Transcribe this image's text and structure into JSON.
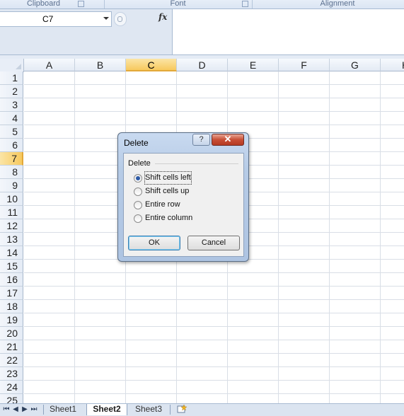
{
  "ribbon": {
    "groups": [
      "Clipboard",
      "Font",
      "Alignment"
    ]
  },
  "formula_bar": {
    "name_box": "C7",
    "fx_label": "fx",
    "content": ""
  },
  "grid": {
    "columns": [
      "A",
      "B",
      "C",
      "D",
      "E",
      "F",
      "G",
      "H"
    ],
    "rows": [
      "1",
      "2",
      "3",
      "4",
      "5",
      "6",
      "7",
      "8",
      "9",
      "10",
      "11",
      "12",
      "13",
      "14",
      "15",
      "16",
      "17",
      "18",
      "19",
      "20",
      "21",
      "22",
      "23",
      "24",
      "25"
    ],
    "selected_column": "C",
    "selected_row": "7"
  },
  "dialog": {
    "title": "Delete",
    "help_label": "?",
    "close_label": "✕",
    "group_label": "Delete",
    "options": [
      {
        "label": "Shift cells left",
        "selected": true
      },
      {
        "label": "Shift cells up",
        "selected": false
      },
      {
        "label": "Entire row",
        "selected": false
      },
      {
        "label": "Entire column",
        "selected": false
      }
    ],
    "ok_label": "OK",
    "cancel_label": "Cancel"
  },
  "sheets": {
    "nav": [
      "⏮",
      "◀",
      "▶",
      "⏭"
    ],
    "tabs": [
      "Sheet1",
      "Sheet2",
      "Sheet3"
    ],
    "active": "Sheet2",
    "new_sheet_icon": "insert-worksheet-icon"
  }
}
